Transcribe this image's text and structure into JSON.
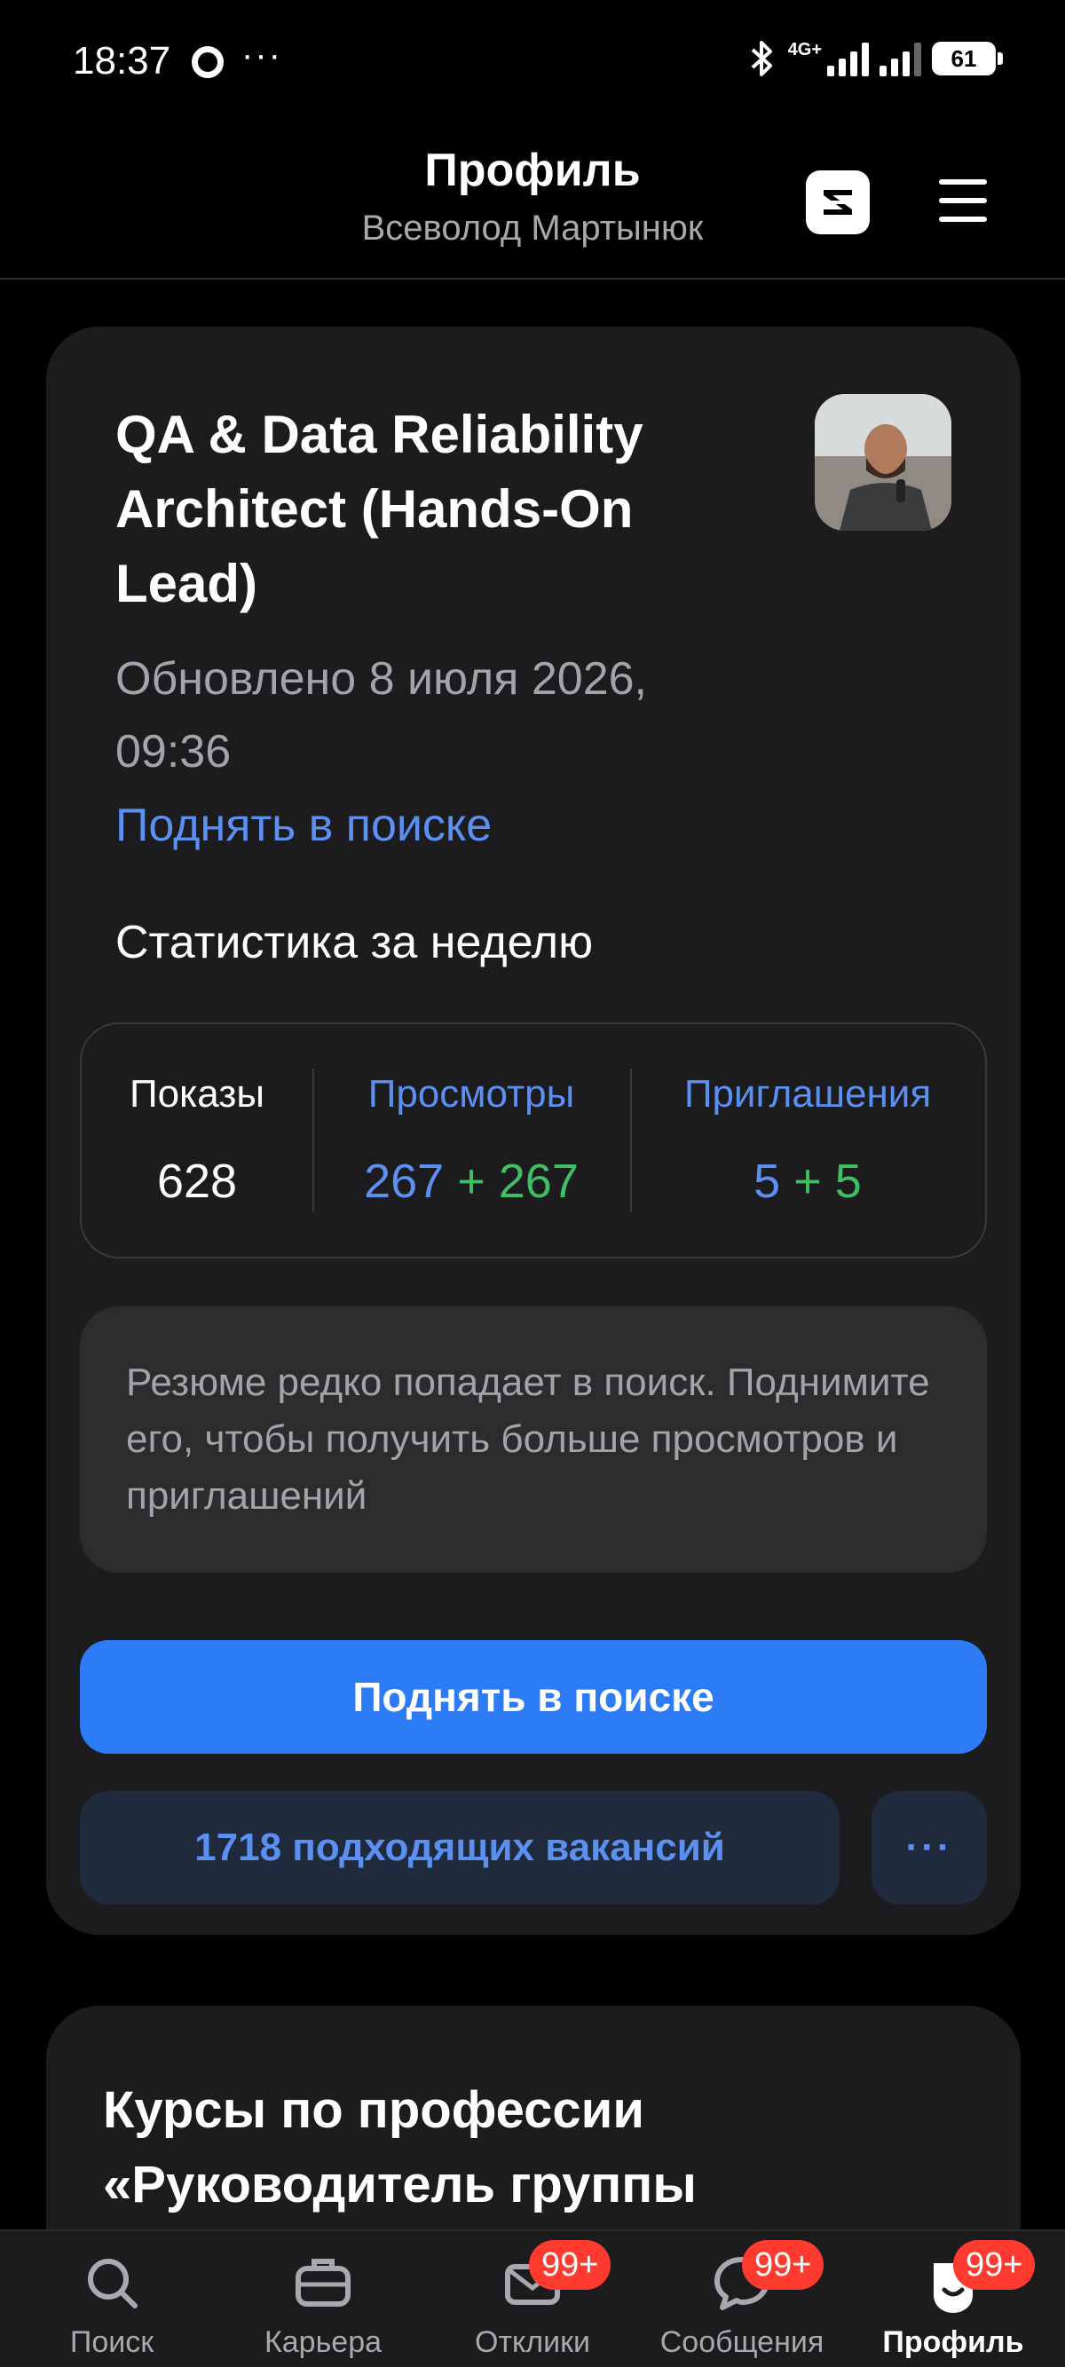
{
  "status_bar": {
    "time": "18:37",
    "more": "···",
    "network": "4G+",
    "battery": "61"
  },
  "header": {
    "title": "Профиль",
    "subtitle": "Всеволод Мартынюк"
  },
  "resume": {
    "title": "QA & Data Reliability Architect (Hands-On Lead)",
    "updated": "Обновлено 8 июля 2026, 09:36",
    "raise_link": "Поднять в поиске",
    "stats_heading": "Статистика за неделю",
    "stats": {
      "impressions_label": "Показы",
      "impressions_value": "628",
      "views_label": "Просмотры",
      "views_base": "267",
      "views_plus": "+ 267",
      "invites_label": "Приглашения",
      "invites_base": "5",
      "invites_plus": "+ 5"
    },
    "hint": "Резюме редко попадает в поиск. Поднимите его, чтобы получить больше просмотров и приглашений",
    "primary_button": "Поднять в поиске",
    "vacancies_button": "1718 подходящих вакансий",
    "more_button": "···"
  },
  "courses": {
    "title": "Курсы по профессии «Руководитель группы"
  },
  "bottom_nav": {
    "items": [
      {
        "label": "Поиск",
        "icon": "search-icon"
      },
      {
        "label": "Карьера",
        "icon": "briefcase-icon"
      },
      {
        "label": "Отклики",
        "icon": "envelope-icon",
        "badge": "99+"
      },
      {
        "label": "Сообщения",
        "icon": "chat-bubble-icon",
        "badge": "99+"
      },
      {
        "label": "Профиль",
        "icon": "profile-icon",
        "badge": "99+"
      }
    ]
  },
  "colors": {
    "accent": "#2d7cf6",
    "link": "#5b8ff0",
    "positive": "#3fbf63",
    "badge": "#ff3b30",
    "card": "#1c1c1e"
  }
}
